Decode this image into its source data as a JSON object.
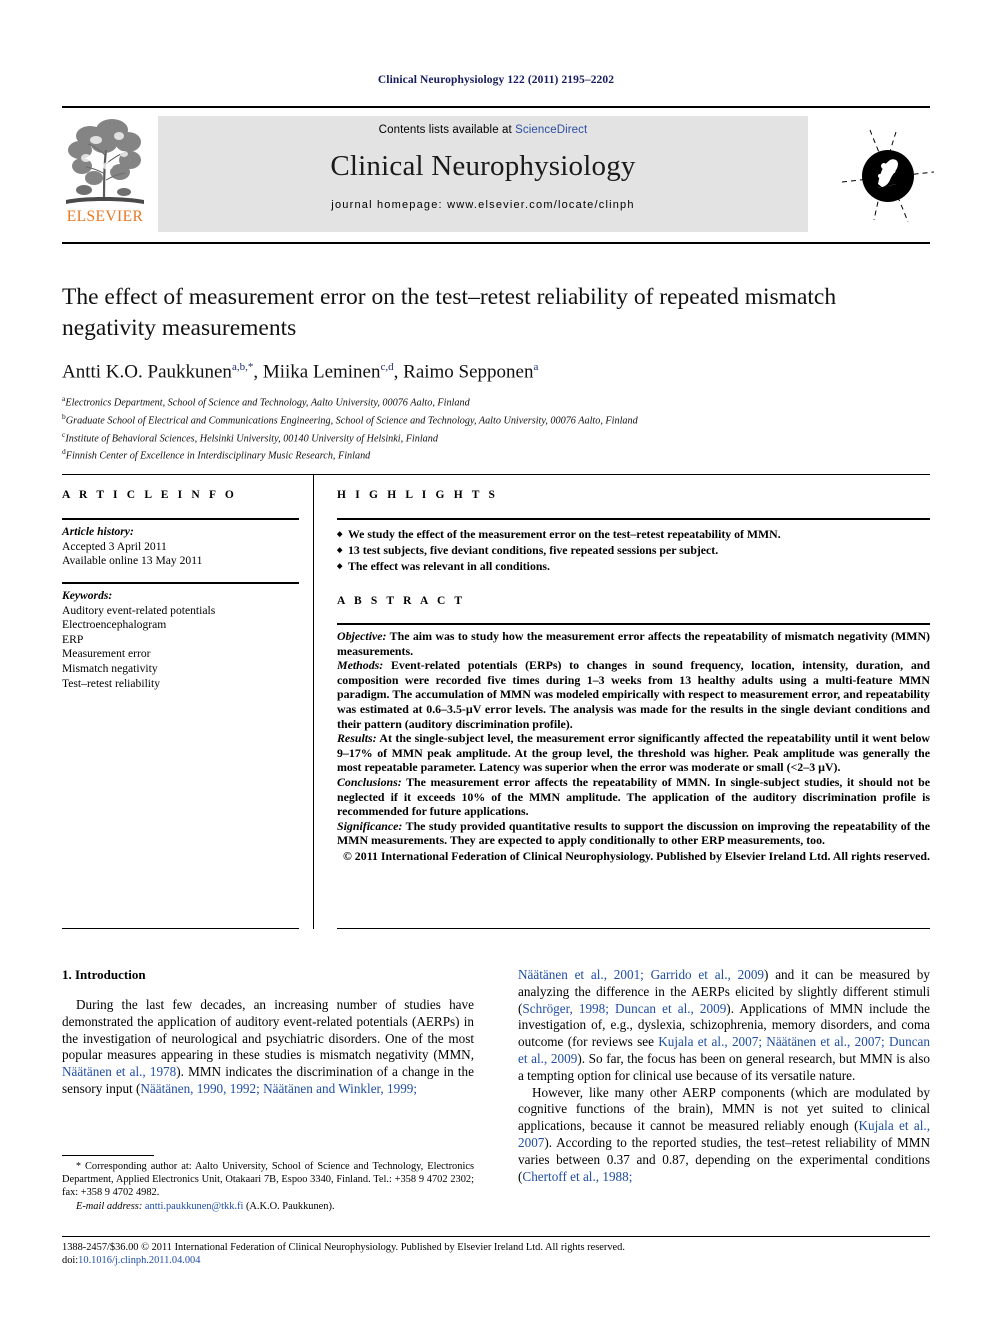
{
  "running_head": "Clinical Neurophysiology 122 (2011) 2195–2202",
  "masthead": {
    "publisher_name": "ELSEVIER",
    "contents_prefix": "Contents lists available at ",
    "sciencedirect": "ScienceDirect",
    "journal_name": "Clinical Neurophysiology",
    "homepage": "journal homepage: www.elsevier.com/locate/clinph"
  },
  "article": {
    "title": "The effect of measurement error on the test–retest reliability of repeated mismatch negativity measurements",
    "authors_line": "Antti K.O. Paukkunen",
    "author1": "Antti K.O. Paukkunen",
    "author1_sup": "a,b,*",
    "author2": "Miika Leminen",
    "author2_sup": "c,d",
    "author3": "Raimo Sepponen",
    "author3_sup": "a",
    "affiliations": [
      {
        "marker": "a",
        "text": "Electronics Department, School of Science and Technology, Aalto University, 00076 Aalto, Finland"
      },
      {
        "marker": "b",
        "text": "Graduate School of Electrical and Communications Engineering, School of Science and Technology, Aalto University, 00076 Aalto, Finland"
      },
      {
        "marker": "c",
        "text": "Institute of Behavioral Sciences, Helsinki University, 00140 University of Helsinki, Finland"
      },
      {
        "marker": "d",
        "text": "Finnish Center of Excellence in Interdisciplinary Music Research, Finland"
      }
    ]
  },
  "headings": {
    "article_info": "A R T I C L E    I N F O",
    "highlights": "H I G H L I G H T S",
    "abstract": "A B S T R A C T"
  },
  "article_info": {
    "history_label": "Article history:",
    "accepted": "Accepted 3 April 2011",
    "available_online": "Available online 13 May 2011",
    "keywords_label": "Keywords:",
    "keywords": [
      "Auditory event-related potentials",
      "Electroencephalogram",
      "ERP",
      "Measurement error",
      "Mismatch negativity",
      "Test–retest reliability"
    ]
  },
  "highlights": [
    "We study the effect of the measurement error on the test–retest repeatability of MMN.",
    "13 test subjects, five deviant conditions, five repeated sessions per subject.",
    "The effect was relevant in all conditions."
  ],
  "abstract": {
    "objective_label": "Objective:",
    "objective": " The aim was to study how the measurement error affects the repeatability of mismatch negativity (MMN) measurements.",
    "methods_label": "Methods:",
    "methods": " Event-related potentials (ERPs) to changes in sound frequency, location, intensity, duration, and composition were recorded five times during 1–3 weeks from 13 healthy adults using a multi-feature MMN paradigm. The accumulation of MMN was modeled empirically with respect to measurement error, and repeatability was estimated at 0.6–3.5-µV error levels. The analysis was made for the results in the single deviant conditions and their pattern (auditory discrimination profile).",
    "results_label": "Results:",
    "results": " At the single-subject level, the measurement error significantly affected the repeatability until it went below 9–17% of MMN peak amplitude. At the group level, the threshold was higher. Peak amplitude was generally the most repeatable parameter. Latency was superior when the error was moderate or small (<2–3 µV).",
    "conclusions_label": "Conclusions:",
    "conclusions": " The measurement error affects the repeatability of MMN. In single-subject studies, it should not be neglected if it exceeds 10% of the MMN amplitude. The application of the auditory discrimination profile is recommended for future applications.",
    "significance_label": "Significance:",
    "significance": " The study provided quantitative results to support the discussion on improving the repeatability of the MMN measurements. They are expected to apply conditionally to other ERP measurements, too.",
    "copyright": "© 2011 International Federation of Clinical Neurophysiology. Published by Elsevier Ireland Ltd. All rights reserved."
  },
  "body": {
    "section_heading": "1. Introduction",
    "left_col": {
      "p1_a": "During the last few decades, an increasing number of studies have demonstrated the application of auditory event-related potentials (AERPs) in the investigation of neurological and psychiatric disorders. One of the most popular measures appearing in these studies is mismatch negativity (MMN, ",
      "p1_cite1": "Näätänen et al., 1978",
      "p1_b": "). MMN indicates the discrimination of a change in the sensory input (",
      "p1_cite2": "Näätänen, 1990, 1992; Näätänen and Winkler, 1999;"
    },
    "right_col": {
      "p1_cite1": "Näätänen et al., 2001; Garrido et al., 2009",
      "p1_a": ") and it can be measured by analyzing the difference in the AERPs elicited by slightly different stimuli (",
      "p1_cite2": "Schröger, 1998; Duncan et al., 2009",
      "p1_b": "). Applications of MMN include the investigation of, e.g., dyslexia, schizophrenia, memory disorders, and coma outcome (for reviews see ",
      "p1_cite3": "Kujala et al., 2007; Näätänen et al., 2007; Duncan et al., 2009",
      "p1_c": "). So far, the focus has been on general research, but MMN is also a tempting option for clinical use because of its versatile nature.",
      "p2_a": "However, like many other AERP components (which are modulated by cognitive functions of the brain), MMN is not yet suited to clinical applications, because it cannot be measured reliably enough (",
      "p2_cite1": "Kujala et al., 2007",
      "p2_b": "). According to the reported studies, the test–retest reliability of MMN varies between 0.37 and 0.87, depending on the experimental conditions (",
      "p2_cite2": "Chertoff et al., 1988;"
    }
  },
  "footnote": {
    "star": "*",
    "corresponding": " Corresponding author at: Aalto University, School of Science and Technology, Electronics Department, Applied Electronics Unit, Otakaari 7B, Espoo 3340, Finland. Tel.: +358 9 4702 2302; fax: +358 9 4702 4982.",
    "email_label": "E-mail address:",
    "email": "antti.paukkunen@tkk.fi",
    "email_suffix": " (A.K.O. Paukkunen)."
  },
  "imprint": {
    "line1": "1388-2457/$36.00 © 2011 International Federation of Clinical Neurophysiology. Published by Elsevier Ireland Ltd. All rights reserved.",
    "doi_label": "doi:",
    "doi": "10.1016/j.clinph.2011.04.004"
  },
  "colors": {
    "running_head": "#151b5e",
    "citation_blue": "#1f4ea1",
    "elsevier_orange": "#e87722",
    "banner_gray": "#e3e3e3"
  }
}
